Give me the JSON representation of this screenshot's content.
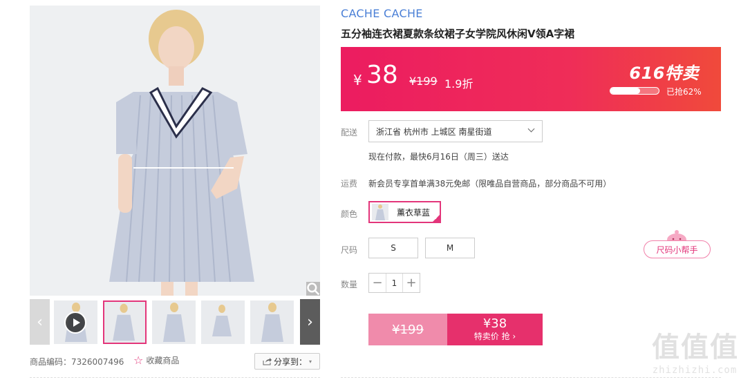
{
  "product": {
    "brand": "CACHE CACHE",
    "title": "五分袖连衣裙夏款条纹裙子女学院风休闲V领A字裙"
  },
  "price": {
    "currency": "¥",
    "current": "38",
    "original": "¥199",
    "discount": "1.9折",
    "promo_title": "616特卖",
    "sold_text": "已抢62%",
    "sold_fraction": 0.62
  },
  "delivery": {
    "label": "配送",
    "address": "浙江省 杭州市 上城区 南星街道",
    "eta": "现在付款，最快6月16日（周三）送达"
  },
  "shipping": {
    "label": "运费",
    "text": "新会员专享首单满38元免邮（限唯品自营商品，部分商品不可用）"
  },
  "color": {
    "label": "颜色",
    "selected": "薰衣草蓝"
  },
  "size": {
    "label": "尺码",
    "options": [
      "S",
      "M"
    ],
    "helper": "尺码小帮手"
  },
  "quantity": {
    "label": "数量",
    "value": "1",
    "minus": "−",
    "plus": "+"
  },
  "buy": {
    "original": "¥199",
    "price": "¥38",
    "label": "特卖价 抢 ›"
  },
  "meta": {
    "sku": "商品编码：7326007496",
    "favorite": "收藏商品",
    "share": "分享到："
  },
  "watermark": {
    "chars": [
      "值",
      "值",
      "值"
    ],
    "url": "zhizhizhi.com"
  },
  "colors": {
    "accent": "#e3357a",
    "banner_start": "#ec1c60",
    "banner_end": "#f04a3b",
    "brand_blue": "#4a7fd6"
  },
  "icons": {
    "zoom": "magnifier-icon",
    "play": "play-icon",
    "favorite": "star-icon",
    "share": "share-icon"
  }
}
